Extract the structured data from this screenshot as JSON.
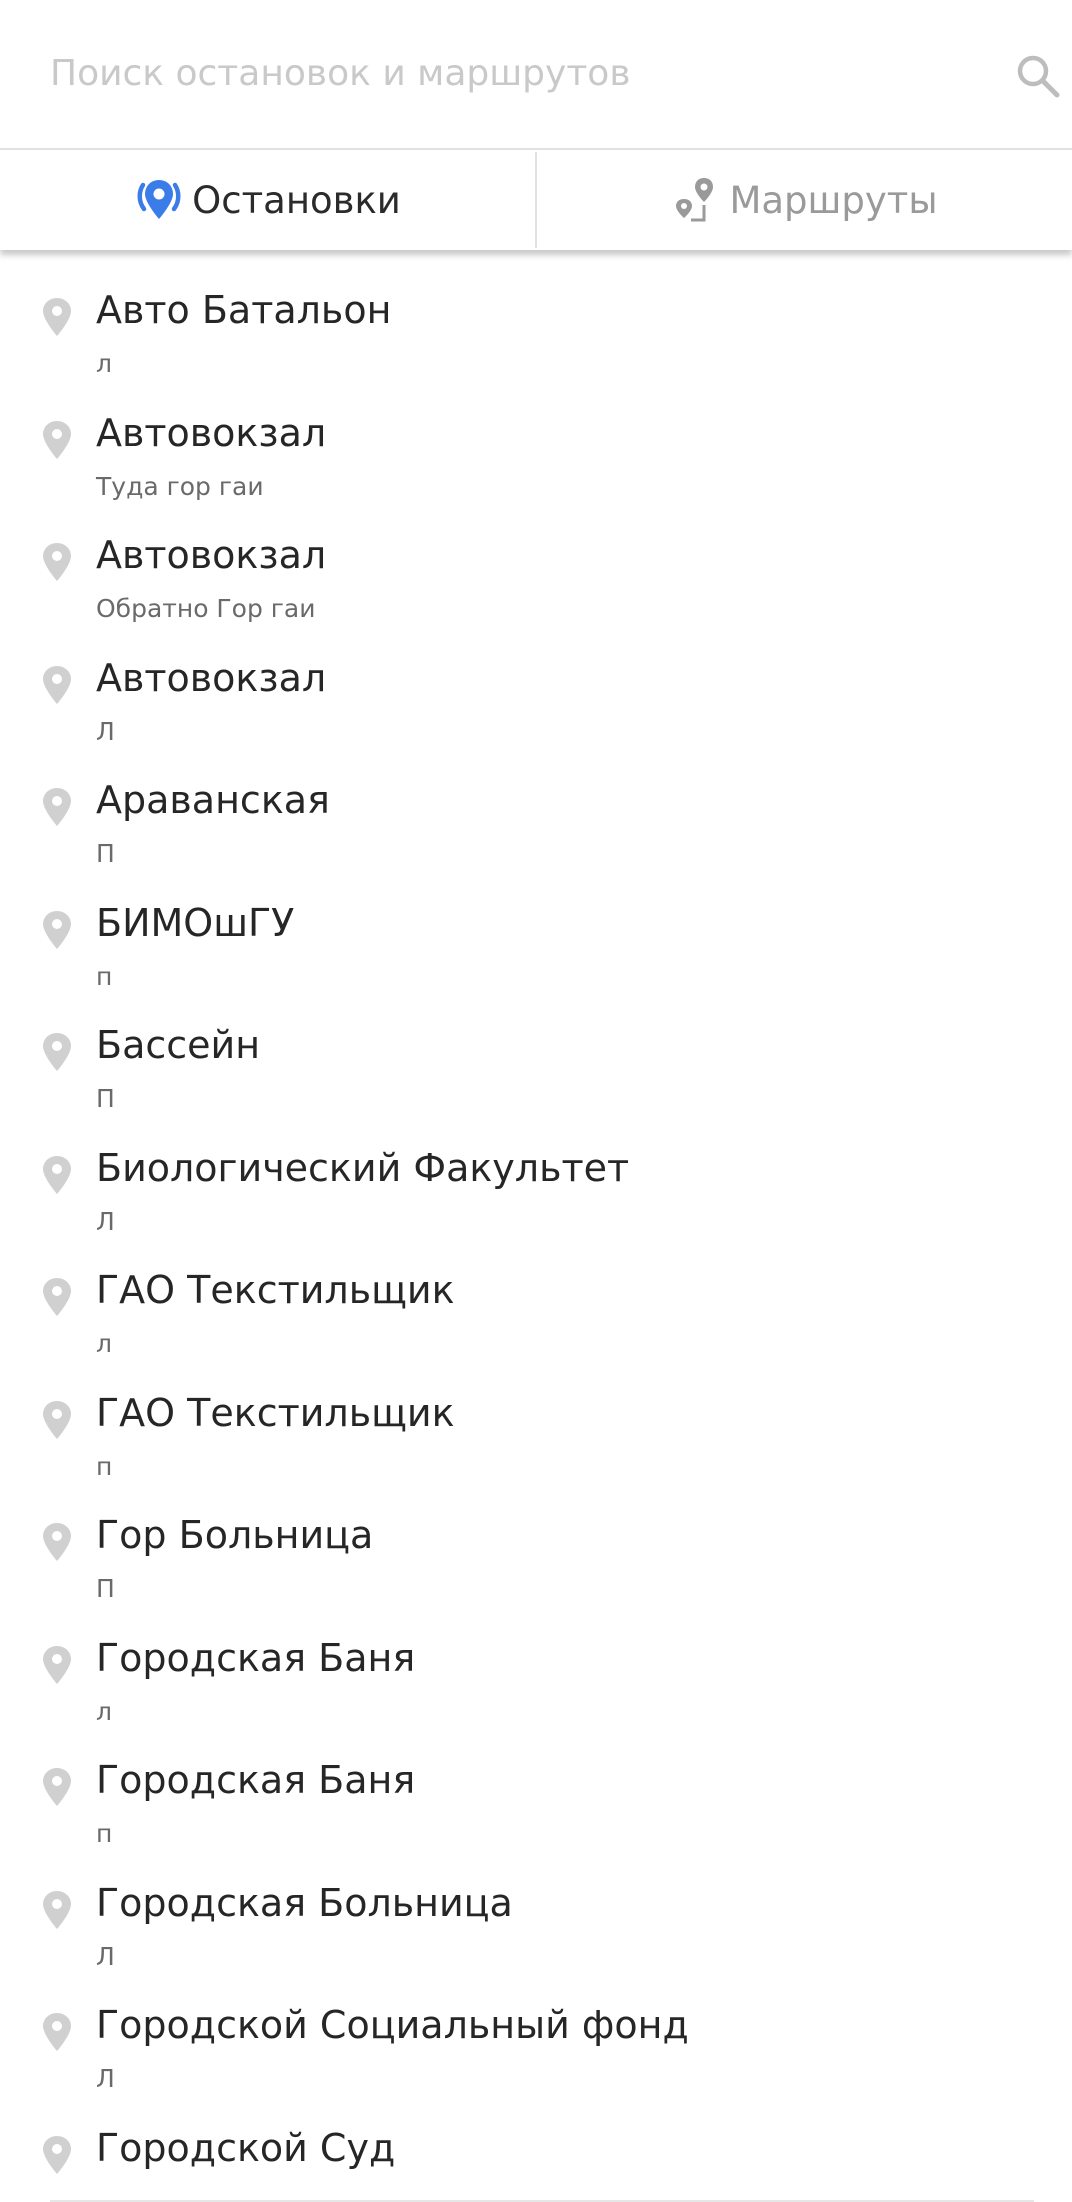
{
  "search": {
    "placeholder": "Поиск остановок и маршрутов",
    "value": ""
  },
  "tabs": [
    {
      "label": "Остановки",
      "icon": "stop-pin-icon",
      "active": true
    },
    {
      "label": "Маршруты",
      "icon": "route-icon",
      "active": false
    }
  ],
  "colors": {
    "accent": "#3b7de8",
    "pin_gray": "#d0d0d0",
    "inactive_tab": "#9a9a9a"
  },
  "stops": [
    {
      "name": "Авто Батальон",
      "direction": "л"
    },
    {
      "name": "Автовокзал",
      "direction": "Туда гор гаи"
    },
    {
      "name": "Автовокзал",
      "direction": "Обратно Гор гаи"
    },
    {
      "name": "Автовокзал",
      "direction": "Л"
    },
    {
      "name": "Араванская",
      "direction": "П"
    },
    {
      "name": "БИМОшГУ",
      "direction": "п"
    },
    {
      "name": "Бассейн",
      "direction": "П"
    },
    {
      "name": "Биологический Факультет",
      "direction": "Л"
    },
    {
      "name": "ГАО Текстильщик",
      "direction": "л"
    },
    {
      "name": "ГАО Текстильщик",
      "direction": "п"
    },
    {
      "name": "Гор Больница",
      "direction": "П"
    },
    {
      "name": "Городская Баня",
      "direction": "л"
    },
    {
      "name": "Городская Баня",
      "direction": "п"
    },
    {
      "name": "Городская Больница",
      "direction": "Л"
    },
    {
      "name": "Городской Социальный фонд",
      "direction": "Л"
    },
    {
      "name": "Городской Суд",
      "direction": ""
    }
  ]
}
